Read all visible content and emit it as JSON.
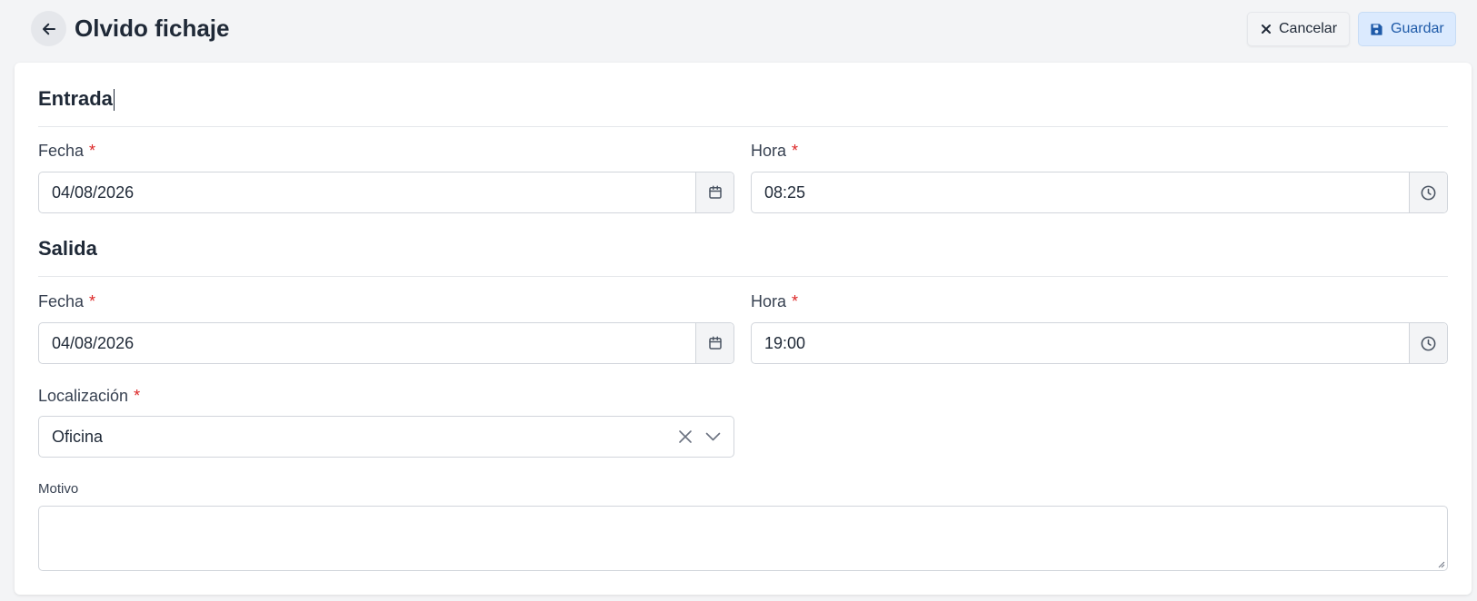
{
  "header": {
    "title": "Olvido fichaje",
    "cancel_label": "Cancelar",
    "save_label": "Guardar",
    "back_icon": "arrow-left-icon",
    "cancel_icon": "close-icon",
    "save_icon": "floppy-disk-icon"
  },
  "entrada": {
    "title": "Entrada",
    "fecha_label": "Fecha",
    "fecha_value": "04/08/2026",
    "hora_label": "Hora",
    "hora_value": "08:25"
  },
  "salida": {
    "title": "Salida",
    "fecha_label": "Fecha",
    "fecha_value": "04/08/2026",
    "hora_label": "Hora",
    "hora_value": "19:00"
  },
  "localizacion": {
    "label": "Localización",
    "value": "Oficina"
  },
  "motivo": {
    "label": "Motivo",
    "value": ""
  },
  "required_marker": "*",
  "colors": {
    "accent": "#1e5aa8",
    "required": "#dc2626",
    "background": "#f3f4f6"
  }
}
